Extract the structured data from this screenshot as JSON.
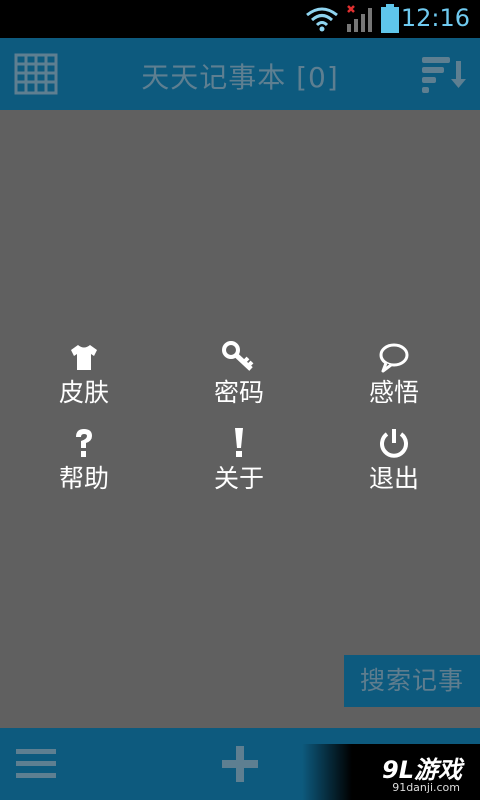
{
  "status_bar": {
    "time": "12:16",
    "icons": [
      "wifi-icon",
      "signal-icon",
      "battery-icon"
    ]
  },
  "header": {
    "title": "天天记事本 [0]",
    "left_icon": "grid-icon",
    "right_icon": "sort-icon"
  },
  "menu": {
    "items": [
      {
        "label": "皮肤",
        "icon": "tshirt-icon"
      },
      {
        "label": "密码",
        "icon": "key-icon"
      },
      {
        "label": "感悟",
        "icon": "speech-bubble-icon"
      },
      {
        "label": "帮助",
        "icon": "question-icon"
      },
      {
        "label": "关于",
        "icon": "exclamation-icon"
      },
      {
        "label": "退出",
        "icon": "power-icon"
      }
    ]
  },
  "search": {
    "label": "搜索记事"
  },
  "bottom_bar": {
    "left_icon": "hamburger-icon",
    "center_icon": "plus-icon"
  },
  "watermark": {
    "main": "9L游戏",
    "sub": "91danji.com"
  },
  "colors": {
    "background": "#606060",
    "bar": "#0d5a7e",
    "accent_text": "#5e7f91"
  }
}
